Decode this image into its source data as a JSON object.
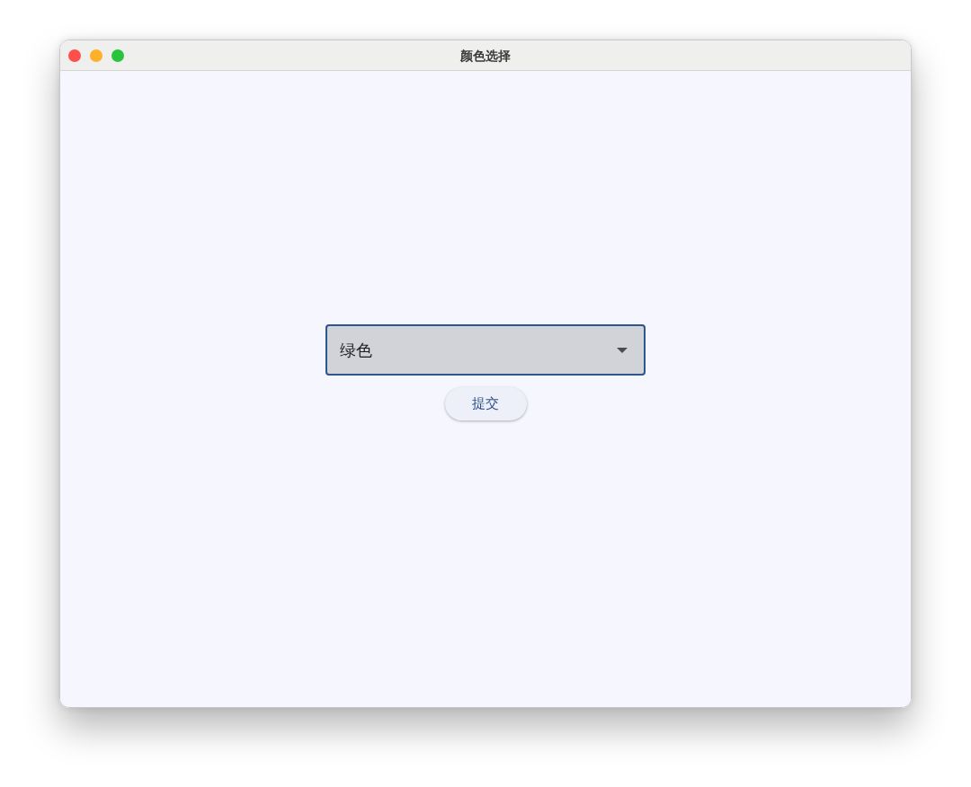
{
  "window": {
    "title": "颜色选择"
  },
  "dropdown": {
    "value": "绿色",
    "focused": true
  },
  "buttons": [
    {
      "label": "提交"
    }
  ]
}
